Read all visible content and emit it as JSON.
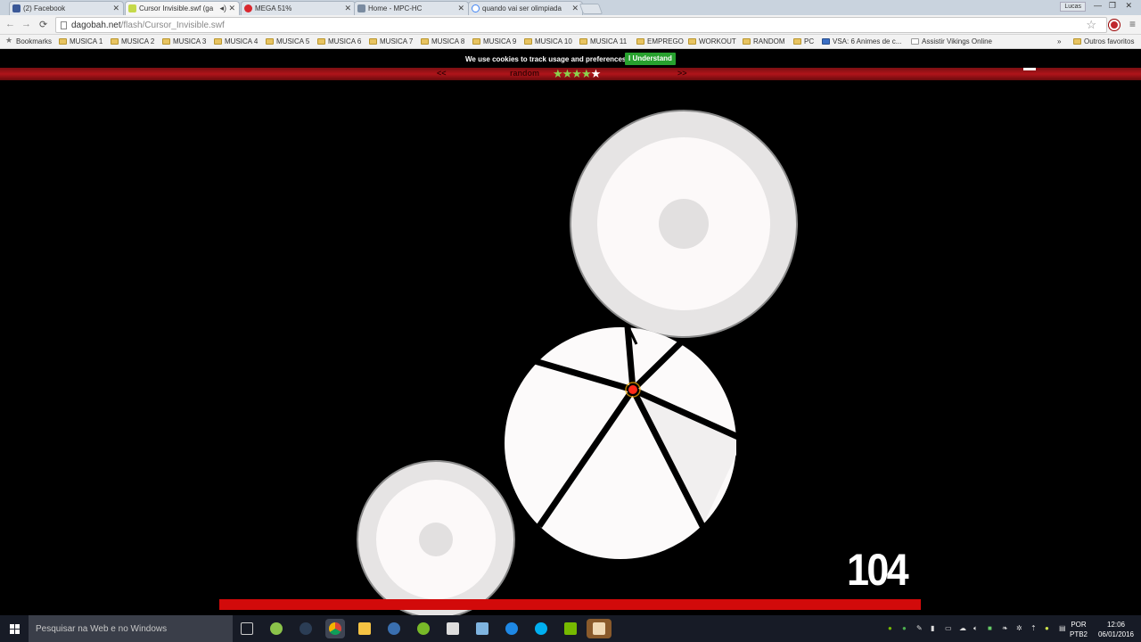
{
  "browser": {
    "tabs": [
      {
        "title": "(2) Facebook",
        "color": "#3b5998",
        "active": false
      },
      {
        "title": "Cursor Invisible.swf (ga",
        "color": "#c5d94a",
        "active": true
      },
      {
        "title": "MEGA 51%",
        "color": "#d9272e",
        "active": false
      },
      {
        "title": "Home - MPC-HC",
        "color": "#7a8ba0",
        "active": false
      },
      {
        "title": "quando vai ser olimpiada",
        "color": "#4285f4",
        "active": false
      }
    ],
    "user": "Lucas",
    "url_domain": "dagobah.net",
    "url_path": "/flash/Cursor_Invisible.swf",
    "bookmarks": [
      "Bookmarks",
      "MUSICA 1",
      "MUSICA 2",
      "MUSICA 3",
      "MUSICA 4",
      "MUSICA 5",
      "MUSICA 6",
      "MUSICA 7",
      "MUSICA 8",
      "MUSICA 9",
      "MUSICA 10",
      "MUSICA 11",
      "EMPREGO",
      "WORKOUT",
      "RANDOM",
      "PC",
      "VSA: 6 Animes de c...",
      "Assistir Vikings Online"
    ],
    "bookmarks_more": "»",
    "other_bookmarks": "Outros favoritos"
  },
  "site": {
    "cookie_text": "We use cookies to track usage and preferences.",
    "cookie_button": "I Understand",
    "nav_prev": "<<",
    "nav_random": "random",
    "nav_next": ">>",
    "rating_stars": 5
  },
  "game": {
    "score": "104",
    "timer_remaining": 1.0
  },
  "taskbar": {
    "search_placeholder": "Pesquisar na Web e no Windows",
    "lang": "POR",
    "lang2": "PTB2",
    "time": "12:06",
    "date": "06/01/2016"
  }
}
